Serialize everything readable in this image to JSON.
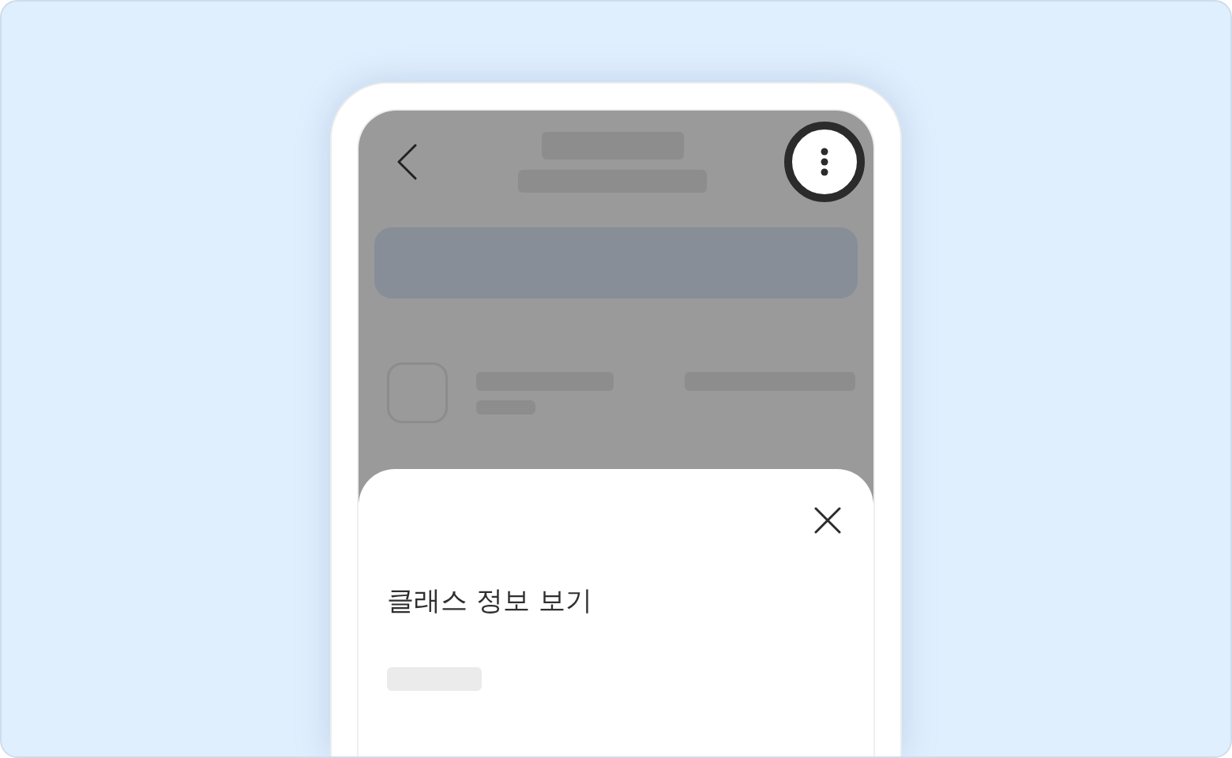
{
  "screen": {
    "dimmed": true,
    "header": {
      "more_button": {
        "highlighted": true
      }
    }
  },
  "bottom_sheet": {
    "title": "클래스 정보 보기"
  }
}
